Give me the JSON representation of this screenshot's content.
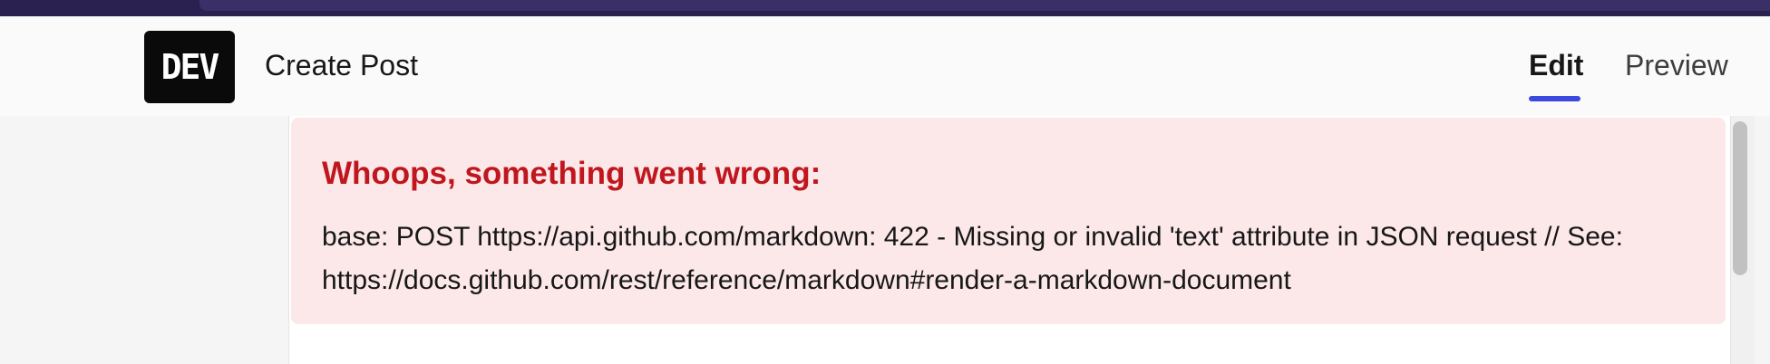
{
  "header": {
    "logo_text": "DEV",
    "page_title": "Create Post",
    "tabs": [
      {
        "label": "Edit",
        "active": true
      },
      {
        "label": "Preview",
        "active": false
      }
    ]
  },
  "error": {
    "title": "Whoops, something went wrong:",
    "message": "base: POST https://api.github.com/markdown: 422 - Missing or invalid 'text' attribute in JSON request // See: https://docs.github.com/rest/reference/markdown#render-a-markdown-document"
  },
  "colors": {
    "accent": "#3b49df",
    "error_text": "#c0161e",
    "error_background": "#fce8e9"
  }
}
